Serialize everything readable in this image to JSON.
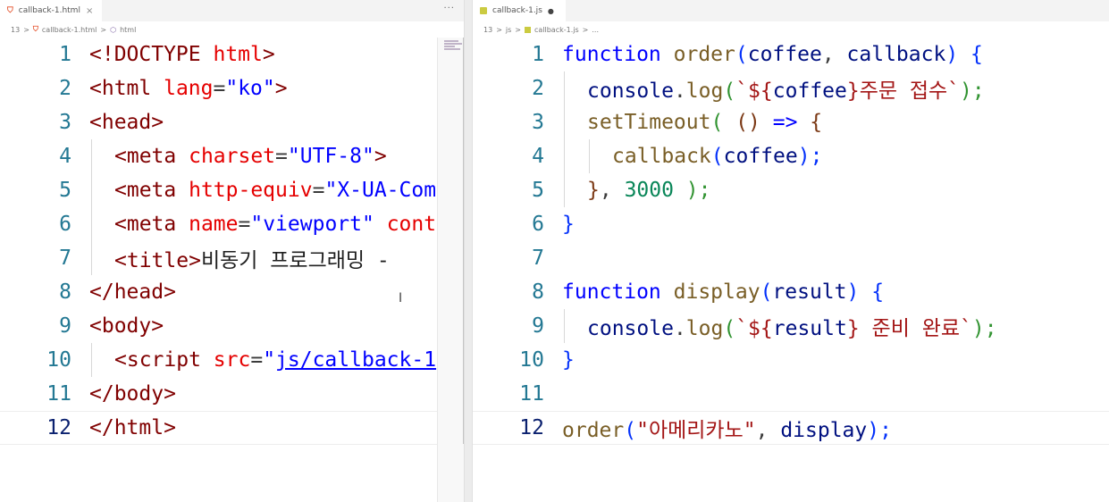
{
  "left": {
    "tab": {
      "icon": "html5-file-icon",
      "title": "callback-1.html",
      "close": "×"
    },
    "actions": "···",
    "breadcrumb": {
      "num": "13",
      "sep": ">",
      "file": "callback-1.html",
      "symbol": "html"
    },
    "lines": [
      {
        "n": "1"
      },
      {
        "n": "2"
      },
      {
        "n": "3"
      },
      {
        "n": "4"
      },
      {
        "n": "5"
      },
      {
        "n": "6"
      },
      {
        "n": "7"
      },
      {
        "n": "8"
      },
      {
        "n": "9"
      },
      {
        "n": "10"
      },
      {
        "n": "11"
      },
      {
        "n": "12"
      }
    ],
    "code": {
      "l1": [
        "<!DOCTYPE",
        " html",
        ">"
      ],
      "l2": [
        "<html",
        " lang",
        "=",
        "\"ko\"",
        ">"
      ],
      "l3": [
        "<head>"
      ],
      "l4": [
        "<meta",
        " charset",
        "=",
        "\"UTF-8\"",
        ">"
      ],
      "l5": [
        "<meta",
        " http-equiv",
        "=",
        "\"X-UA-Com"
      ],
      "l6": [
        "<meta",
        " name",
        "=",
        "\"viewport\"",
        " cont"
      ],
      "l7": [
        "<title>",
        "비동기 프로그래밍 -"
      ],
      "l8": [
        "</head>"
      ],
      "l9": [
        "<body>"
      ],
      "l10": [
        "<script",
        " src",
        "=",
        "\"",
        "js/callback-1"
      ],
      "l11": [
        "</body>"
      ],
      "l12": [
        "</html>"
      ]
    }
  },
  "right": {
    "tab": {
      "icon": "js-file-icon",
      "title": "callback-1.js",
      "dirty": "●"
    },
    "breadcrumb": {
      "num": "13",
      "sep": ">",
      "folder": "js",
      "file": "callback-1.js",
      "more": "..."
    },
    "lines": [
      {
        "n": "1"
      },
      {
        "n": "2"
      },
      {
        "n": "3"
      },
      {
        "n": "4"
      },
      {
        "n": "5"
      },
      {
        "n": "6"
      },
      {
        "n": "7"
      },
      {
        "n": "8"
      },
      {
        "n": "9"
      },
      {
        "n": "10"
      },
      {
        "n": "11"
      },
      {
        "n": "12"
      }
    ],
    "code": {
      "l1": [
        "function",
        " order",
        "(",
        "coffee",
        ", ",
        "callback",
        ")",
        " {"
      ],
      "l2": [
        "console",
        ".",
        "log",
        "(",
        "`${",
        "coffee",
        "}주문 접수`",
        ");"
      ],
      "l3": [
        "setTimeout",
        "(",
        " (",
        ")",
        " =>",
        " {"
      ],
      "l4": [
        "callback",
        "(",
        "coffee",
        ");"
      ],
      "l5": [
        "}",
        ", ",
        "3000",
        " );"
      ],
      "l6": [
        "}"
      ],
      "l8": [
        "function",
        " display",
        "(",
        "result",
        ")",
        " {"
      ],
      "l9": [
        "console",
        ".",
        "log",
        "(",
        "`${",
        "result",
        "} 준비 완료`",
        ");"
      ],
      "l10": [
        "}"
      ],
      "l12": [
        "order",
        "(",
        "\"아메리카노\"",
        ", ",
        "display",
        ");"
      ]
    }
  },
  "colors": {
    "tag": "#800000",
    "attr": "#e50000",
    "string": "#0000ff",
    "keyword": "#0000ff",
    "function": "#795e26",
    "number": "#098658",
    "line_number": "#237893",
    "html_icon": "#e44d26",
    "js_icon": "#cbcb41"
  }
}
